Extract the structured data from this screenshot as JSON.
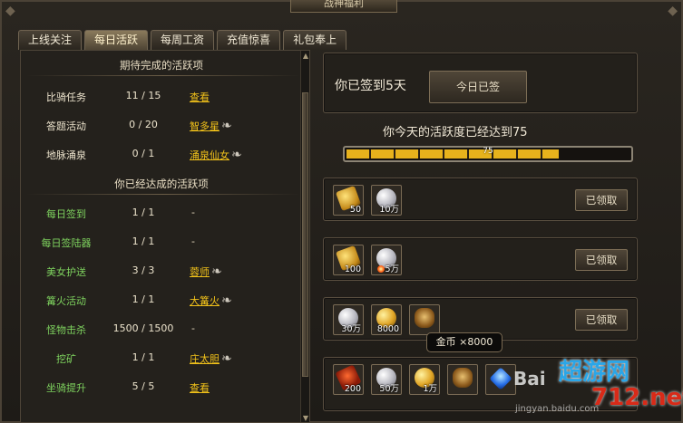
{
  "window": {
    "title": "战神福利"
  },
  "tabs": [
    "上线关注",
    "每日活跃",
    "每周工资",
    "充值惊喜",
    "礼包奉上"
  ],
  "active_tab": 1,
  "left": {
    "pending_title": "期待完成的活跃项",
    "pending": [
      {
        "name": "比骑任务",
        "count": "11 / 15",
        "link": "查看",
        "wing": false
      },
      {
        "name": "答题活动",
        "count": "0 / 20",
        "link": "智多星",
        "wing": true
      },
      {
        "name": "地脉涌泉",
        "count": "0 / 1",
        "link": "涌泉仙女",
        "wing": true
      }
    ],
    "done_title": "你已经达成的活跃项",
    "done": [
      {
        "name": "每日签到",
        "count": "1 / 1",
        "link": "",
        "dash": "-",
        "wing": false
      },
      {
        "name": "每日签陆器",
        "count": "1 / 1",
        "link": "",
        "dash": "-",
        "wing": false
      },
      {
        "name": "美女护送",
        "count": "3 / 3",
        "link": "蓉师",
        "wing": true
      },
      {
        "name": "篝火活动",
        "count": "1 / 1",
        "link": "大篝火",
        "wing": true
      },
      {
        "name": "怪物击杀",
        "count": "1500 / 1500",
        "link": "",
        "dash": "-",
        "wing": false
      },
      {
        "name": "挖矿",
        "count": "1 / 1",
        "link": "庄太胆",
        "wing": true
      },
      {
        "name": "坐骑提升",
        "count": "5 / 5",
        "link": "查看",
        "wing": false
      }
    ],
    "scroll": {
      "up": "▲",
      "down": "▼"
    }
  },
  "right": {
    "signin_text": "你已签到5天",
    "signin_button": "今日已签",
    "activity_text": "你今天的活跃度已经达到75",
    "progress": {
      "value": 75,
      "max": 100,
      "label": "75"
    },
    "rewards": [
      {
        "items": [
          {
            "icon": "gold-ingot-icon",
            "cls": "ico-gold-ingot",
            "count": "50"
          },
          {
            "icon": "silver-coin-icon",
            "cls": "ico-silver",
            "count": "10万"
          }
        ],
        "button": "已领取"
      },
      {
        "items": [
          {
            "icon": "gold-ingot-icon",
            "cls": "ico-gold-ingot",
            "count": "100"
          },
          {
            "icon": "silver-coin-icon",
            "cls": "ico-silver",
            "count": "5万"
          }
        ],
        "button": "已领取"
      },
      {
        "items": [
          {
            "icon": "silver-coin-icon",
            "cls": "ico-silver",
            "count": "30万"
          },
          {
            "icon": "gold-coin-icon",
            "cls": "ico-gold",
            "count": "8000"
          },
          {
            "icon": "medal-icon",
            "cls": "ico-medal",
            "count": ""
          }
        ],
        "button": "已领取"
      },
      {
        "items": [
          {
            "icon": "red-ingot-icon",
            "cls": "ico-red",
            "count": "200"
          },
          {
            "icon": "silver-coin-icon",
            "cls": "ico-silver",
            "count": "50万"
          },
          {
            "icon": "gold-coin-icon",
            "cls": "ico-gold",
            "count": "1万"
          },
          {
            "icon": "medal-icon",
            "cls": "ico-medal",
            "count": ""
          },
          {
            "icon": "blue-gem-icon",
            "cls": "ico-blue",
            "count": ""
          }
        ],
        "button": ""
      }
    ],
    "tooltip": "金币 ×8000"
  },
  "watermark": {
    "logo": "Bai",
    "cn": "超游网",
    "net": "712.net",
    "url": "jingyan.baidu.com"
  }
}
